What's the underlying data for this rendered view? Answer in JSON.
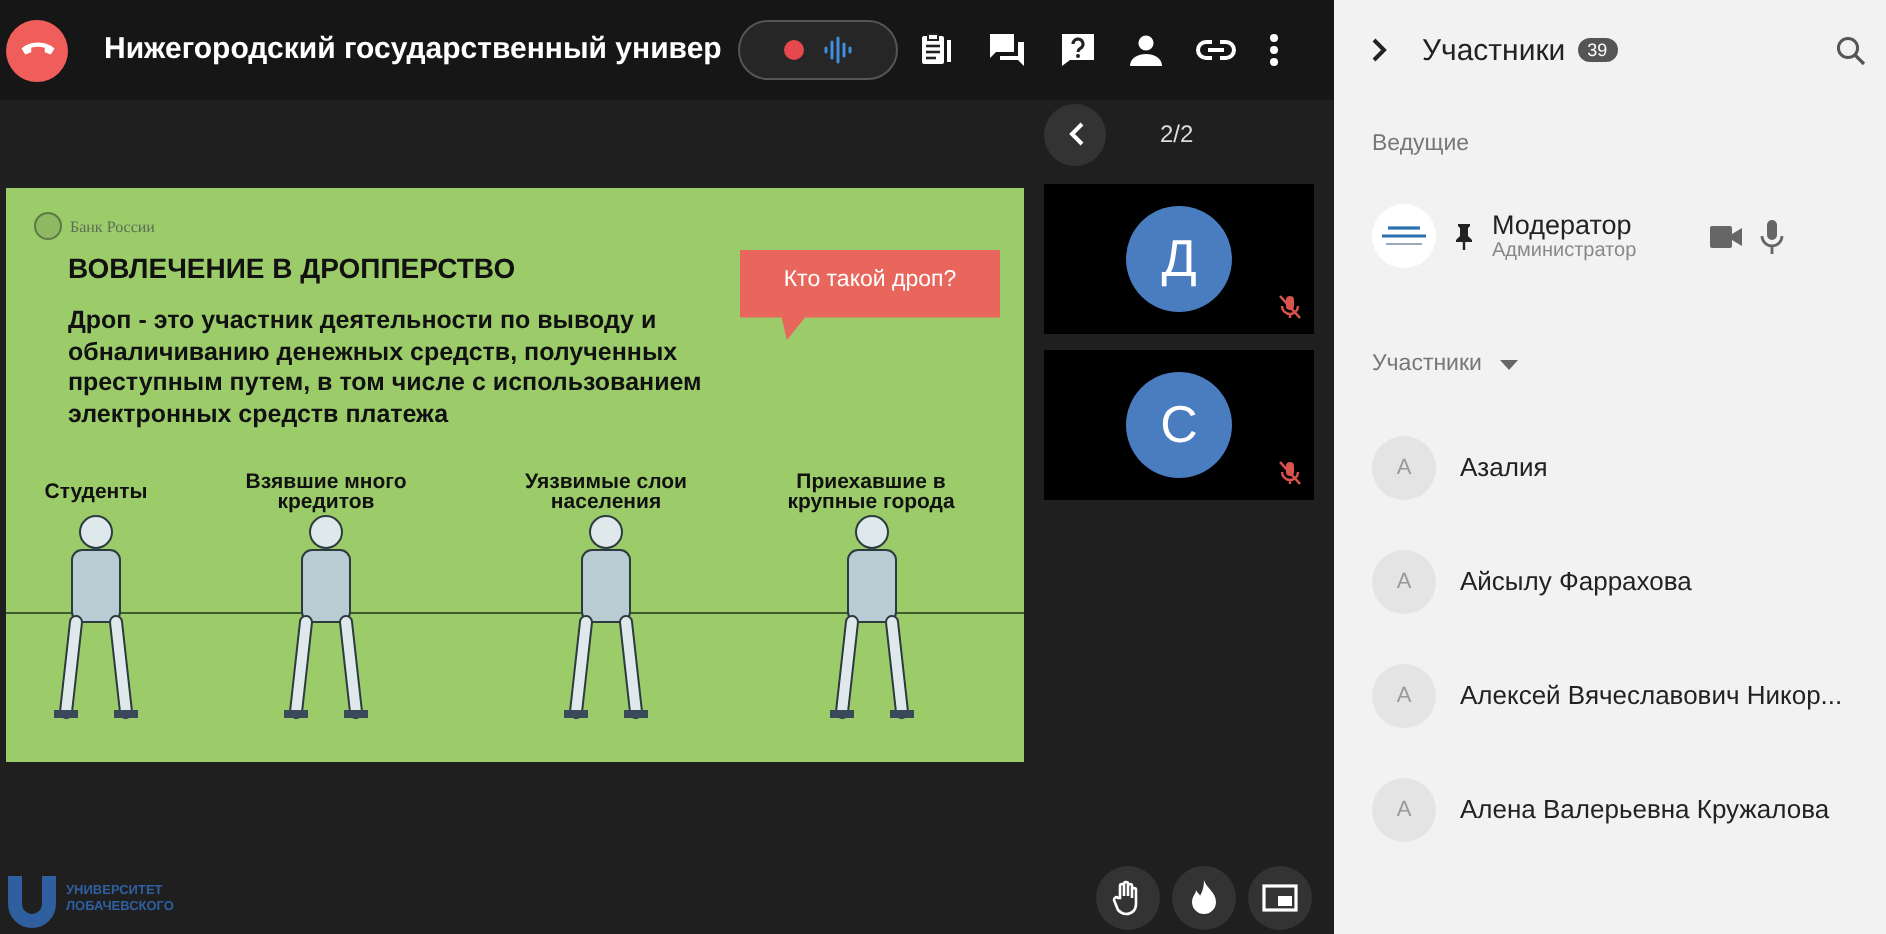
{
  "call": {
    "title": "Нижегородский государственный универ"
  },
  "pager": {
    "label": "2/2"
  },
  "slide": {
    "brand": "Банк России",
    "heading": "ВОВЛЕЧЕНИЕ В ДРОППЕРСТВО",
    "callout": "Кто такой дроп?",
    "definition": "Дроп - это участник деятельности по выводу и обналичиванию денежных средств, полученных преступным путем, в том числе с использованием электронных средств платежа",
    "groups": [
      {
        "label": "Студенты"
      },
      {
        "label": "Взявшие много кредитов"
      },
      {
        "label": "Уязвимые слои населения"
      },
      {
        "label": "Приехавшие в крупные города"
      }
    ]
  },
  "tiles": [
    {
      "initial": "Д",
      "muted": true
    },
    {
      "initial": "С",
      "muted": true
    }
  ],
  "logo": {
    "line1": "УНИВЕРСИТЕТ",
    "line2": "ЛОБАЧЕВСКОГО"
  },
  "panel": {
    "title": "Участники",
    "count": "39",
    "hosts_label": "Ведущие",
    "hosts": [
      {
        "name": "Модератор",
        "role": "Администратор"
      }
    ],
    "participants_label": "Участники",
    "participants": [
      {
        "initial": "А",
        "name": "Азалия"
      },
      {
        "initial": "А",
        "name": "Айсылу Фаррахова"
      },
      {
        "initial": "А",
        "name": "Алексей Вячеславович Никор..."
      },
      {
        "initial": "А",
        "name": "Алена Валерьевна Кружалова"
      }
    ]
  }
}
